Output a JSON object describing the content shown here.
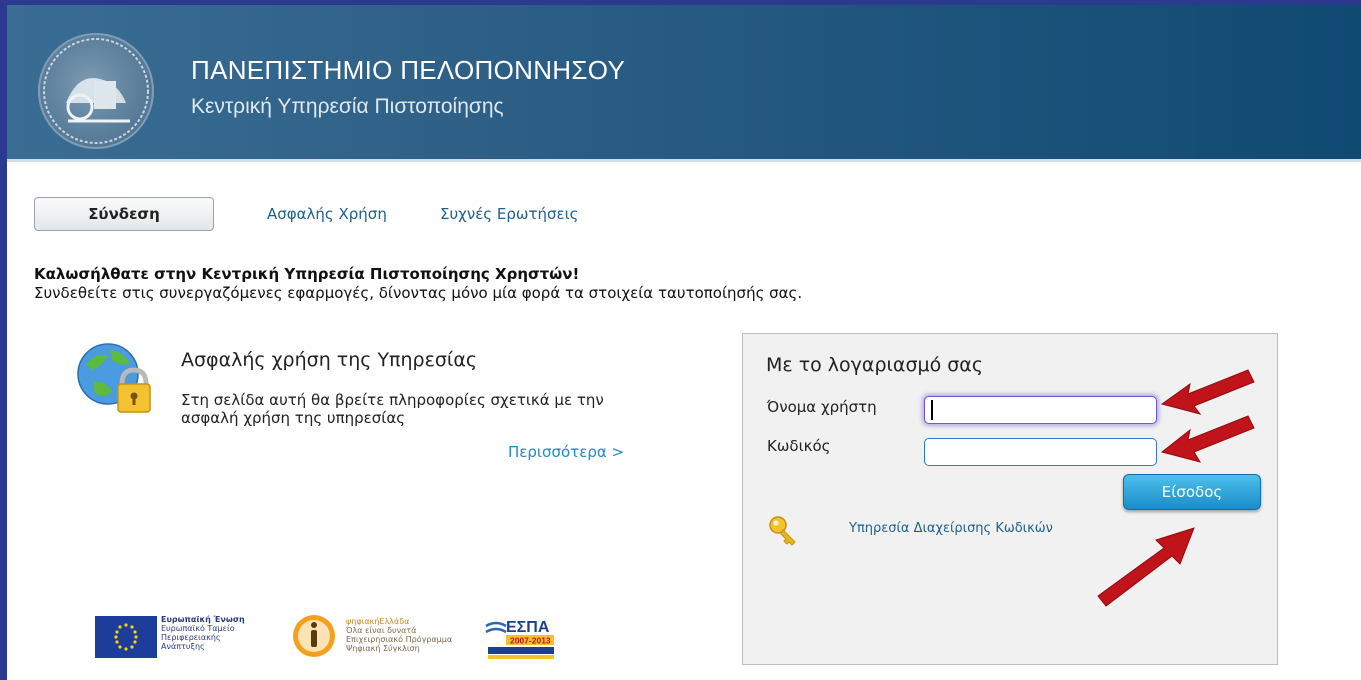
{
  "header": {
    "university": "ΠΑΝΕΠΙΣΤΗΜΙΟ ΠΕΛΟΠΟΝΝΗΣΟΥ",
    "service": "Κεντρική Υπηρεσία Πιστοποίησης"
  },
  "nav": {
    "login": "Σύνδεση",
    "secure_use": "Ασφαλής Χρήση",
    "faq": "Συχνές Ερωτήσεις"
  },
  "welcome": {
    "title": "Καλωσήλθατε στην Κεντρική Υπηρεσία Πιστοποίησης Χρηστών!",
    "subtitle": "Συνδεθείτε στις συνεργαζόμενες εφαρμογές, δίνοντας μόνο μία φορά τα στοιχεία ταυτοποίησής σας."
  },
  "security": {
    "title": "Ασφαλής χρήση της Υπηρεσίας",
    "description": "Στη σελίδα αυτή θα βρείτε πληροφορίες σχετικά με την ασφαλή χρήση της υπηρεσίας",
    "more": "Περισσότερα >"
  },
  "login": {
    "title": "Με το λογαριασμό σας",
    "username_label": "Όνομα χρήστη",
    "username_value": "",
    "password_label": "Κωδικός",
    "password_value": "",
    "submit": "Είσοδος",
    "password_service": "Υπηρεσία Διαχείρισης Κωδικών"
  },
  "footer": {
    "eu_lines": [
      "Ευρωπαϊκή Ένωση",
      "Ευρωπαϊκό Ταμείο",
      "Περιφερειακής",
      "Ανάπτυξης"
    ],
    "digital_lines": [
      "ψηφιακήΕλλάδα",
      "Όλα είναι δυνατά",
      "Επιχειρησιακό Πρόγραμμα",
      "Ψηφιακή Σύγκλιση"
    ],
    "espa_title": "ΕΣΠΑ",
    "espa_years": "2007-2013"
  },
  "colors": {
    "frame": "#2b3a8f",
    "header_start": "#3a6d94",
    "header_end": "#0f4a73",
    "link": "#1f5f8f",
    "button": "#1a8cc9",
    "arrow": "#c0131a"
  }
}
